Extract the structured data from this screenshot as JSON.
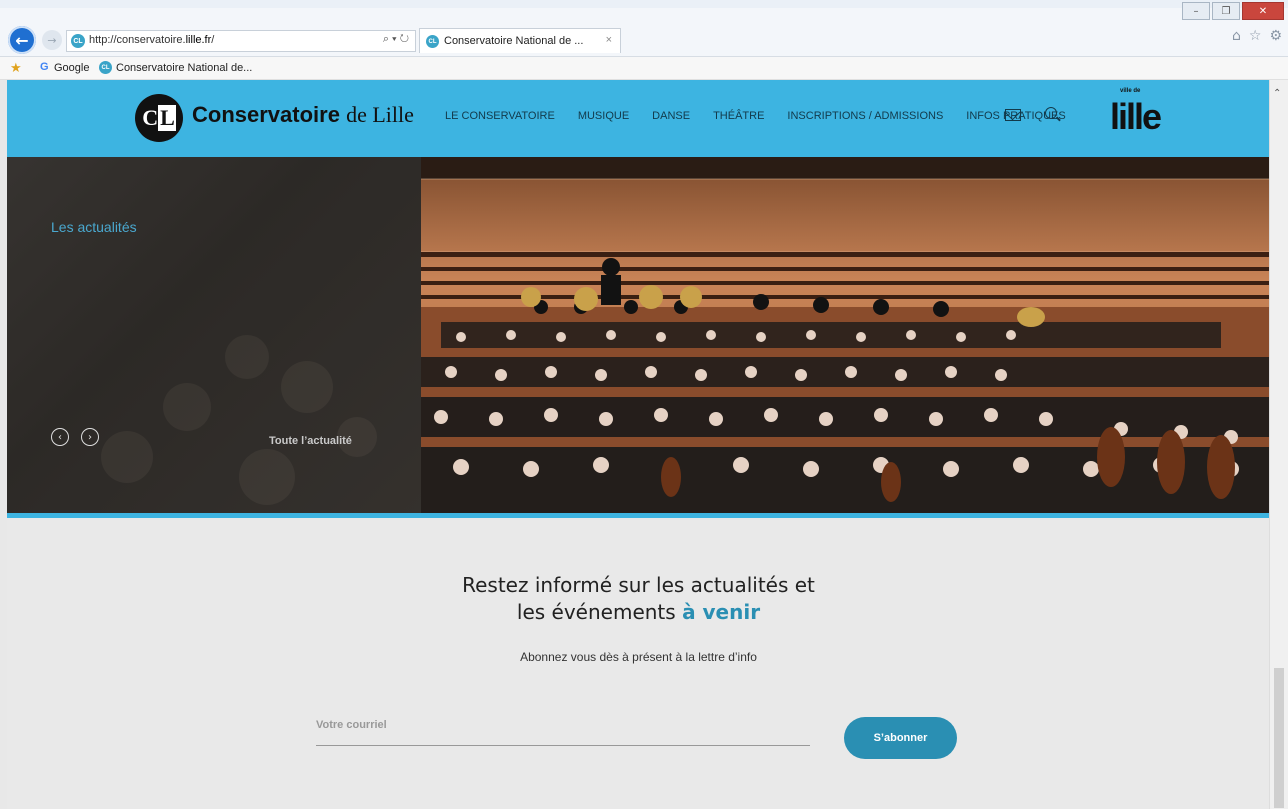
{
  "browser": {
    "url_prefix": "http://conservatoire.",
    "url_domain": "lille.fr",
    "url_suffix": "/",
    "address_controls": "⌕ ▾ ↻",
    "tab_title": "Conservatoire National de ...",
    "tab_close": "×",
    "favorites": [
      "Google",
      "Conservatoire National de..."
    ],
    "window_minimize": "–",
    "window_restore": "❐",
    "window_close": "✕",
    "home_icon": "⌂",
    "star_icon": "☆",
    "gear_icon": "⚙"
  },
  "header": {
    "logo_mark_c": "C",
    "logo_mark_l": "L",
    "logo_bold": "Conservatoire",
    "logo_serif": "de Lille",
    "nav": [
      "LE CONSERVATOIRE",
      "MUSIQUE",
      "DANSE",
      "THÉÂTRE",
      "INSCRIPTIONS / ADMISSIONS",
      "INFOS PRATIQUES"
    ],
    "ville_small": "ville de",
    "ville_big": "lille"
  },
  "hero": {
    "label": "Les actualités",
    "prev": "‹",
    "next": "›",
    "all_news": "Toute l’actualité"
  },
  "newsletter": {
    "title_line1": "Restez informé sur les actualités et",
    "title_line2_plain": "les événements",
    "title_line2_accent": "à venir",
    "subtitle": "Abonnez vous dès à présent à la lettre d’info",
    "email_placeholder": "Votre courriel",
    "subscribe_label": "S’abonner"
  },
  "colors": {
    "brand_blue": "#3db4e1",
    "accent_blue": "#2a8fb3"
  }
}
